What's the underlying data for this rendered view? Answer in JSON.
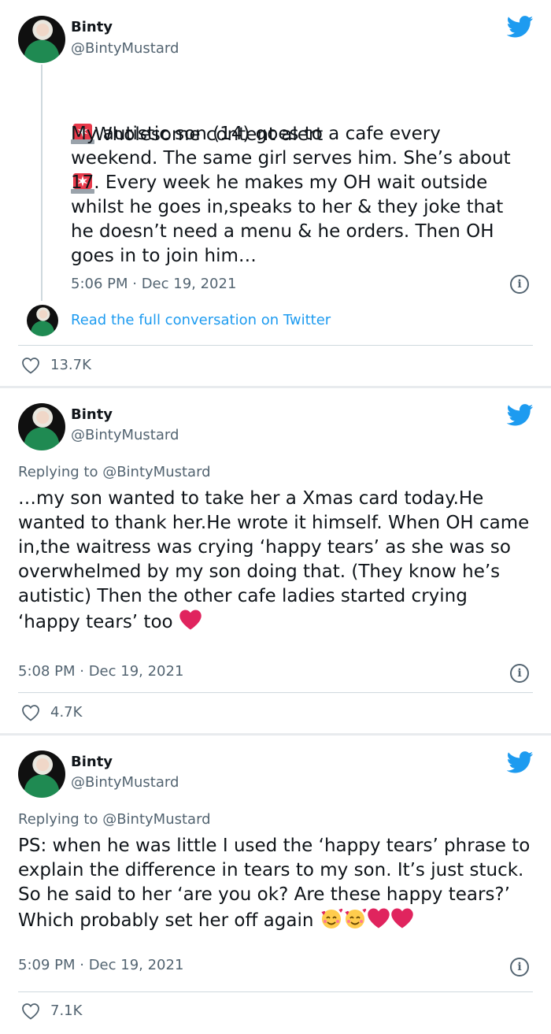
{
  "tweets": [
    {
      "author": "Binty",
      "handle": "@BintyMustard",
      "text_head": "Wholesome content alert",
      "text_body": "My autistic son (14) goes to a cafe every weekend. The same girl serves him. She’s about 17. Every week he makes my OH wait outside whilst he goes in,speaks to her & they joke that he doesn’t need a menu & he orders. Then OH goes in to join him…",
      "time": "5:06 PM · Dec 19, 2021",
      "read_link": "Read the full conversation on Twitter",
      "likes": "13.7K"
    },
    {
      "author": "Binty",
      "handle": "@BintyMustard",
      "replying_prefix": "Replying to ",
      "replying_to": "@BintyMustard",
      "text": "…my son wanted to take her a Xmas card today.He wanted to thank her.He wrote it himself. When OH came in,the waitress was crying ‘happy tears’ as she was so overwhelmed by my son doing that. (They know he’s autistic) Then the other cafe ladies started crying ‘happy tears’ too",
      "time": "5:08 PM · Dec 19, 2021",
      "likes": "4.7K"
    },
    {
      "author": "Binty",
      "handle": "@BintyMustard",
      "replying_prefix": "Replying to ",
      "replying_to": "@BintyMustard",
      "text": "PS: when he was little I used the ‘happy tears’ phrase to explain the difference in tears to my son. It’s just stuck. So he said to her ‘are you ok? Are these happy tears?’ Which probably set her off again",
      "time": "5:09 PM · Dec 19, 2021",
      "likes": "7.1K"
    }
  ],
  "icons": {
    "brand": "twitter-bird-icon",
    "like": "heart-outline-icon",
    "info": "info-icon",
    "alert": "police-light-emoji",
    "heart_emoji": "red-heart-emoji",
    "smile_emoji": "smiling-face-with-hearts-emoji"
  },
  "colors": {
    "link": "#1d9bf0",
    "secondary_text": "#536471",
    "heart_red": "#e0245e",
    "background": "#e8ebee"
  }
}
